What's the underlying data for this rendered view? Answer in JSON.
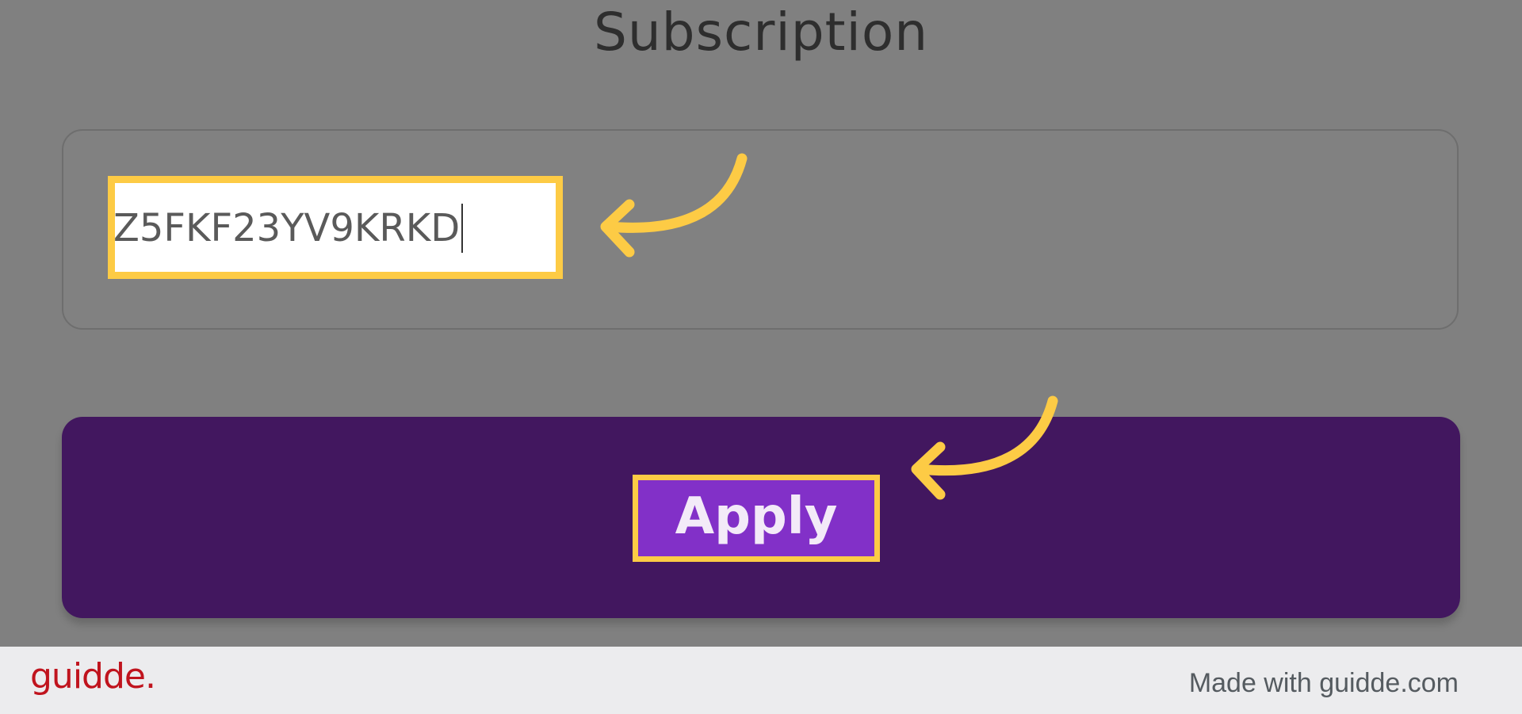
{
  "header": {
    "title": "Subscription"
  },
  "code_field": {
    "value": "Z5FKF23YV9KRKD"
  },
  "apply_button": {
    "label": "Apply",
    "bar_color": "#42175f",
    "highlight_color": "#8230c8"
  },
  "annotations": {
    "highlight_color": "#fdcb45",
    "arrows": [
      "curved-arrow-icon",
      "curved-arrow-icon"
    ]
  },
  "footer": {
    "brand": "guidde.",
    "credit": "Made with guidde.com"
  }
}
